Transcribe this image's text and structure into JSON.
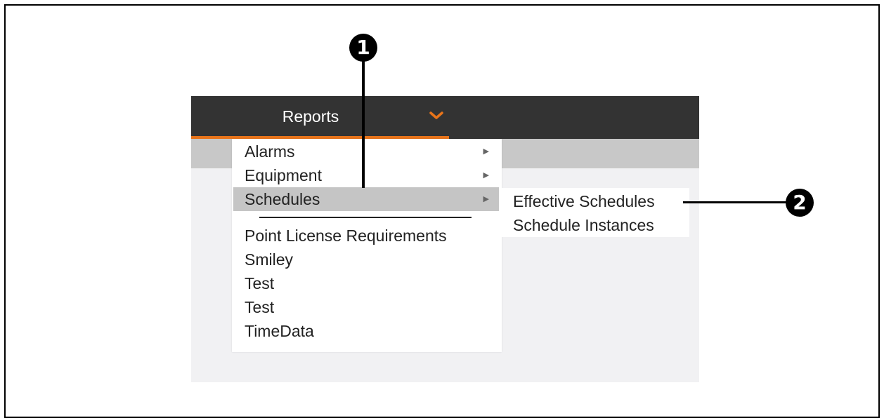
{
  "nav": {
    "reports_label": "Reports",
    "dropdown_icon": "chevron-down-icon",
    "accent_color": "#e8741a"
  },
  "menu": {
    "items": [
      {
        "label": "Alarms",
        "has_submenu": true
      },
      {
        "label": "Equipment",
        "has_submenu": true
      },
      {
        "label": "Schedules",
        "has_submenu": true,
        "highlighted": true
      },
      {
        "label": "Point License Requirements"
      },
      {
        "label": "Smiley"
      },
      {
        "label": "Test"
      },
      {
        "label": "Test"
      },
      {
        "label": "TimeData"
      }
    ]
  },
  "submenu": {
    "items": [
      {
        "label": "Effective Schedules"
      },
      {
        "label": "Schedule Instances"
      }
    ]
  },
  "callouts": {
    "one": "1",
    "two": "2"
  }
}
